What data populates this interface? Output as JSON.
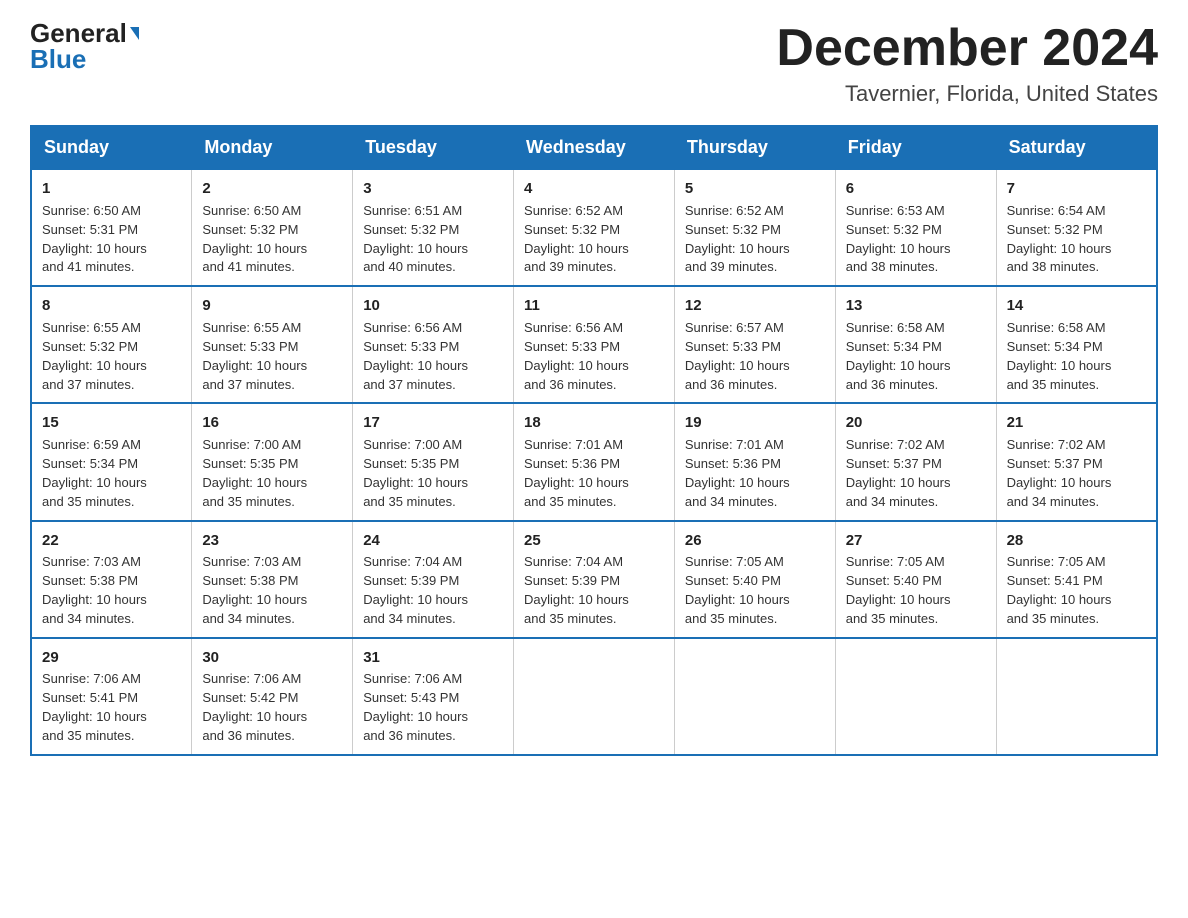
{
  "logo": {
    "line1_normal": "General",
    "line1_arrow": "▶",
    "line2": "Blue"
  },
  "title": {
    "month": "December 2024",
    "location": "Tavernier, Florida, United States"
  },
  "weekdays": [
    "Sunday",
    "Monday",
    "Tuesday",
    "Wednesday",
    "Thursday",
    "Friday",
    "Saturday"
  ],
  "weeks": [
    [
      {
        "day": "1",
        "info": "Sunrise: 6:50 AM\nSunset: 5:31 PM\nDaylight: 10 hours\nand 41 minutes."
      },
      {
        "day": "2",
        "info": "Sunrise: 6:50 AM\nSunset: 5:32 PM\nDaylight: 10 hours\nand 41 minutes."
      },
      {
        "day": "3",
        "info": "Sunrise: 6:51 AM\nSunset: 5:32 PM\nDaylight: 10 hours\nand 40 minutes."
      },
      {
        "day": "4",
        "info": "Sunrise: 6:52 AM\nSunset: 5:32 PM\nDaylight: 10 hours\nand 39 minutes."
      },
      {
        "day": "5",
        "info": "Sunrise: 6:52 AM\nSunset: 5:32 PM\nDaylight: 10 hours\nand 39 minutes."
      },
      {
        "day": "6",
        "info": "Sunrise: 6:53 AM\nSunset: 5:32 PM\nDaylight: 10 hours\nand 38 minutes."
      },
      {
        "day": "7",
        "info": "Sunrise: 6:54 AM\nSunset: 5:32 PM\nDaylight: 10 hours\nand 38 minutes."
      }
    ],
    [
      {
        "day": "8",
        "info": "Sunrise: 6:55 AM\nSunset: 5:32 PM\nDaylight: 10 hours\nand 37 minutes."
      },
      {
        "day": "9",
        "info": "Sunrise: 6:55 AM\nSunset: 5:33 PM\nDaylight: 10 hours\nand 37 minutes."
      },
      {
        "day": "10",
        "info": "Sunrise: 6:56 AM\nSunset: 5:33 PM\nDaylight: 10 hours\nand 37 minutes."
      },
      {
        "day": "11",
        "info": "Sunrise: 6:56 AM\nSunset: 5:33 PM\nDaylight: 10 hours\nand 36 minutes."
      },
      {
        "day": "12",
        "info": "Sunrise: 6:57 AM\nSunset: 5:33 PM\nDaylight: 10 hours\nand 36 minutes."
      },
      {
        "day": "13",
        "info": "Sunrise: 6:58 AM\nSunset: 5:34 PM\nDaylight: 10 hours\nand 36 minutes."
      },
      {
        "day": "14",
        "info": "Sunrise: 6:58 AM\nSunset: 5:34 PM\nDaylight: 10 hours\nand 35 minutes."
      }
    ],
    [
      {
        "day": "15",
        "info": "Sunrise: 6:59 AM\nSunset: 5:34 PM\nDaylight: 10 hours\nand 35 minutes."
      },
      {
        "day": "16",
        "info": "Sunrise: 7:00 AM\nSunset: 5:35 PM\nDaylight: 10 hours\nand 35 minutes."
      },
      {
        "day": "17",
        "info": "Sunrise: 7:00 AM\nSunset: 5:35 PM\nDaylight: 10 hours\nand 35 minutes."
      },
      {
        "day": "18",
        "info": "Sunrise: 7:01 AM\nSunset: 5:36 PM\nDaylight: 10 hours\nand 35 minutes."
      },
      {
        "day": "19",
        "info": "Sunrise: 7:01 AM\nSunset: 5:36 PM\nDaylight: 10 hours\nand 34 minutes."
      },
      {
        "day": "20",
        "info": "Sunrise: 7:02 AM\nSunset: 5:37 PM\nDaylight: 10 hours\nand 34 minutes."
      },
      {
        "day": "21",
        "info": "Sunrise: 7:02 AM\nSunset: 5:37 PM\nDaylight: 10 hours\nand 34 minutes."
      }
    ],
    [
      {
        "day": "22",
        "info": "Sunrise: 7:03 AM\nSunset: 5:38 PM\nDaylight: 10 hours\nand 34 minutes."
      },
      {
        "day": "23",
        "info": "Sunrise: 7:03 AM\nSunset: 5:38 PM\nDaylight: 10 hours\nand 34 minutes."
      },
      {
        "day": "24",
        "info": "Sunrise: 7:04 AM\nSunset: 5:39 PM\nDaylight: 10 hours\nand 34 minutes."
      },
      {
        "day": "25",
        "info": "Sunrise: 7:04 AM\nSunset: 5:39 PM\nDaylight: 10 hours\nand 35 minutes."
      },
      {
        "day": "26",
        "info": "Sunrise: 7:05 AM\nSunset: 5:40 PM\nDaylight: 10 hours\nand 35 minutes."
      },
      {
        "day": "27",
        "info": "Sunrise: 7:05 AM\nSunset: 5:40 PM\nDaylight: 10 hours\nand 35 minutes."
      },
      {
        "day": "28",
        "info": "Sunrise: 7:05 AM\nSunset: 5:41 PM\nDaylight: 10 hours\nand 35 minutes."
      }
    ],
    [
      {
        "day": "29",
        "info": "Sunrise: 7:06 AM\nSunset: 5:41 PM\nDaylight: 10 hours\nand 35 minutes."
      },
      {
        "day": "30",
        "info": "Sunrise: 7:06 AM\nSunset: 5:42 PM\nDaylight: 10 hours\nand 36 minutes."
      },
      {
        "day": "31",
        "info": "Sunrise: 7:06 AM\nSunset: 5:43 PM\nDaylight: 10 hours\nand 36 minutes."
      },
      {
        "day": "",
        "info": ""
      },
      {
        "day": "",
        "info": ""
      },
      {
        "day": "",
        "info": ""
      },
      {
        "day": "",
        "info": ""
      }
    ]
  ]
}
